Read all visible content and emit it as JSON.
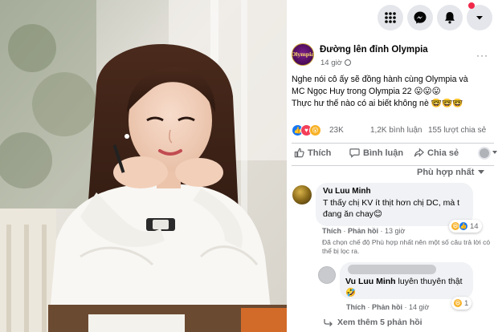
{
  "topbar": {
    "menu_icon": "grid-menu-icon",
    "messenger_icon": "messenger-icon",
    "bell_icon": "bell-icon",
    "account_icon": "caret-down-icon"
  },
  "post": {
    "page_name": "Đường lên đỉnh Olympia",
    "page_avatar_text": "Olympia",
    "time": "14 giờ",
    "more": "···",
    "lines": [
      "Nghe nói cô ấy sẽ đồng hành cùng Olympia và",
      "MC Ngọc Huy trong Olympia 22 😛😛😛",
      "Thực hư thế nào có ai biết không nè 🤓🤓🤓"
    ],
    "reaction_count": "23K",
    "comment_count": "1,2K bình luận",
    "share_count": "155 lượt chia sẻ",
    "actions": {
      "like": "Thích",
      "comment": "Bình luận",
      "share": "Chia sẻ"
    },
    "sort_label": "Phù hợp nhất"
  },
  "comments": [
    {
      "author": "Vu Luu Minh",
      "text": "T thấy chị KV ít thịt hơn chị DC, mà t đang ăn chay😊",
      "reaction_count": "14",
      "like_label": "Thích",
      "reply_label": "Phản hồi",
      "time": "13 giờ",
      "note": "Đã chọn chế độ Phù hợp nhất nên một số câu trả lời có thể bị lọc ra."
    },
    {
      "mention": "Vu Luu Minh",
      "text": " luyên thuyên thật 🤣",
      "reaction_count": "1",
      "like_label": "Thích",
      "reply_label": "Phản hồi",
      "time": "14 giờ"
    }
  ],
  "more_replies": "Xem thêm 5 phản hồi",
  "colors": {
    "accent": "#1877f2",
    "bubble": "#f0f2f5",
    "secondary_text": "#65676b",
    "badge": "#f02849"
  }
}
